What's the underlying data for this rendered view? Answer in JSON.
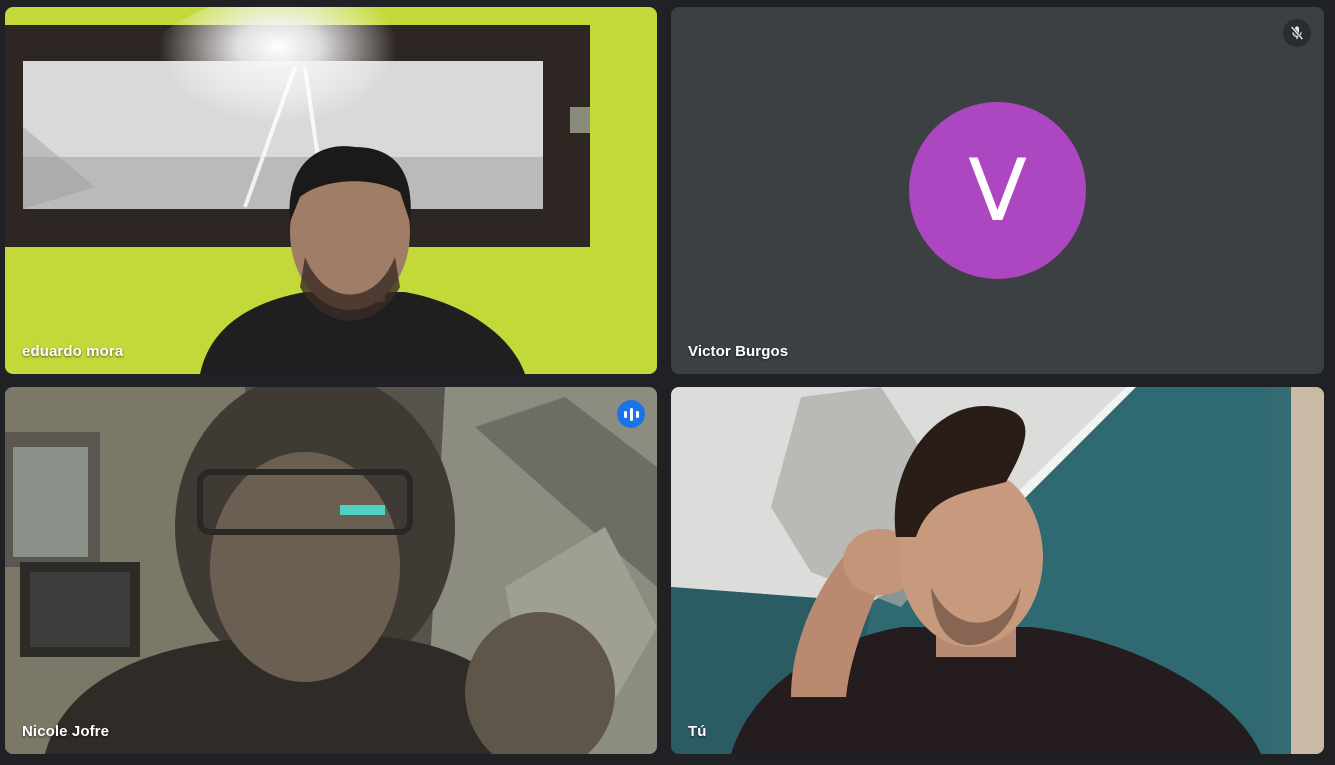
{
  "participants": [
    {
      "name": "eduardo mora",
      "speaking": false,
      "muted": false
    },
    {
      "name": "Victor Burgos",
      "initial": "V",
      "muted": true,
      "avatar_color": "#ad47c1"
    },
    {
      "name": "Nicole Jofre",
      "speaking": true,
      "muted": false
    },
    {
      "name": "Tú",
      "speaking": false,
      "muted": false
    }
  ],
  "colors": {
    "background": "#202124",
    "tile_empty": "#3c4043",
    "speaking_outline": "#8ab4f8",
    "speaking_badge": "#1a73e8"
  },
  "icons": {
    "muted": "mic-off-icon",
    "speaking": "audio-level-icon"
  }
}
